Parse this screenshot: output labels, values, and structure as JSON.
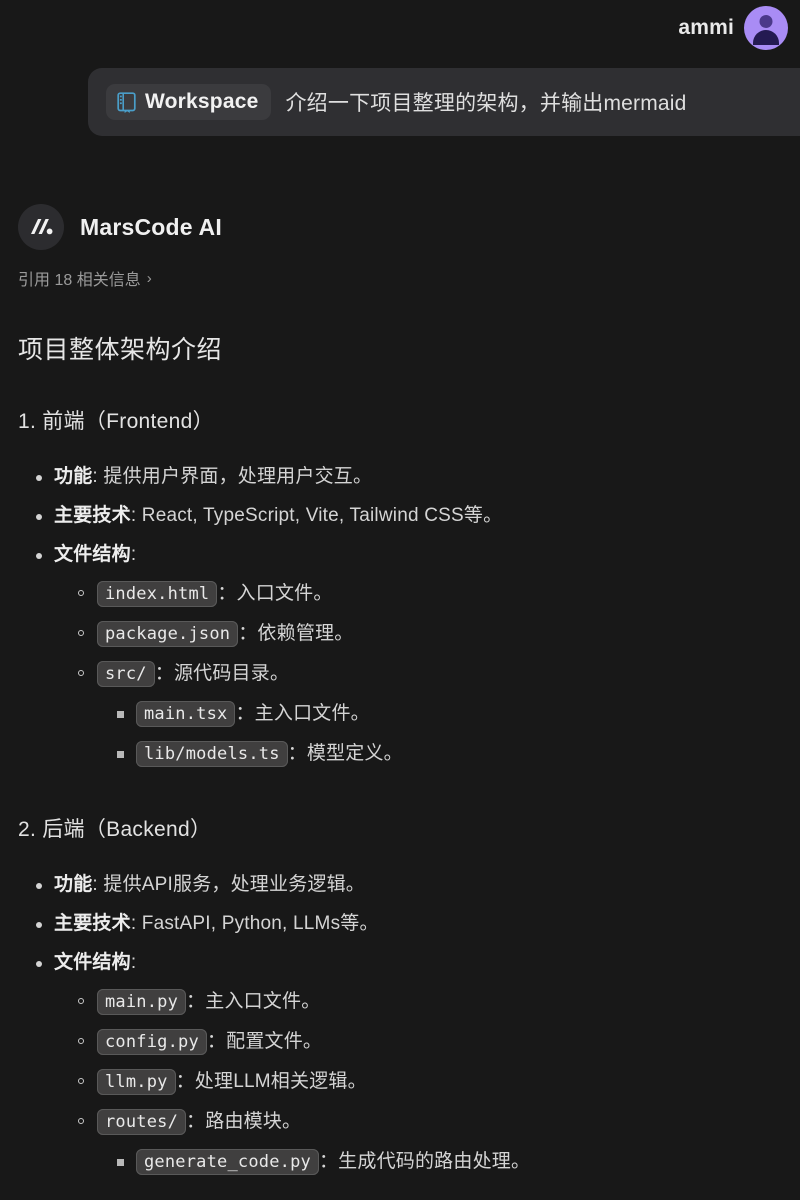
{
  "theme": {
    "background": "#181818",
    "bubble_bg": "#2f2f32",
    "badge_bg": "#3b3b3e",
    "chip_bg": "#403f3f",
    "accent_avatar": "#a98cf5",
    "accent_workspace_icon": "#4a9ec9",
    "text_primary": "#e8e8e8",
    "text_body": "#d4d4d4",
    "text_muted": "#9b9b9b"
  },
  "header": {
    "user_name": "ammi",
    "avatar_icon": "person-icon"
  },
  "user_message": {
    "workspace_badge": {
      "icon": "book-icon",
      "label": "Workspace"
    },
    "prompt": "介绍一下项目整理的架构，并输出mermaid"
  },
  "assistant": {
    "logo_icon": "marscode-logo-icon",
    "name": "MarsCode AI",
    "citation": {
      "text": "引用 18 相关信息",
      "chevron": "›"
    },
    "title": "项目整体架构介绍",
    "sections": [
      {
        "heading": "1. 前端（Frontend）",
        "items": [
          {
            "label": "功能",
            "sep": ": ",
            "desc": "提供用户界面，处理用户交互。"
          },
          {
            "label": "主要技术",
            "sep": ": ",
            "desc": "React, TypeScript, Vite, Tailwind CSS等。"
          },
          {
            "label": "文件结构",
            "sep": ":",
            "desc": ""
          }
        ],
        "files": [
          {
            "code": "index.html",
            "sep": "：",
            "desc": "入口文件。",
            "children": []
          },
          {
            "code": "package.json",
            "sep": "：",
            "desc": "依赖管理。",
            "children": []
          },
          {
            "code": "src/",
            "sep": "：",
            "desc": "源代码目录。",
            "children": [
              {
                "code": "main.tsx",
                "sep": "：",
                "desc": "主入口文件。"
              },
              {
                "code": "lib/models.ts",
                "sep": "：",
                "desc": "模型定义。"
              }
            ]
          }
        ]
      },
      {
        "heading": "2. 后端（Backend）",
        "items": [
          {
            "label": "功能",
            "sep": ": ",
            "desc": "提供API服务，处理业务逻辑。"
          },
          {
            "label": "主要技术",
            "sep": ": ",
            "desc": "FastAPI, Python, LLMs等。"
          },
          {
            "label": "文件结构",
            "sep": ":",
            "desc": ""
          }
        ],
        "files": [
          {
            "code": "main.py",
            "sep": "：",
            "desc": "主入口文件。",
            "children": []
          },
          {
            "code": "config.py",
            "sep": "：",
            "desc": "配置文件。",
            "children": []
          },
          {
            "code": "llm.py",
            "sep": "：",
            "desc": "处理LLM相关逻辑。",
            "children": []
          },
          {
            "code": "routes/",
            "sep": "：",
            "desc": "路由模块。",
            "children": [
              {
                "code": "generate_code.py",
                "sep": "：",
                "desc": "生成代码的路由处理。"
              }
            ]
          }
        ]
      }
    ]
  }
}
